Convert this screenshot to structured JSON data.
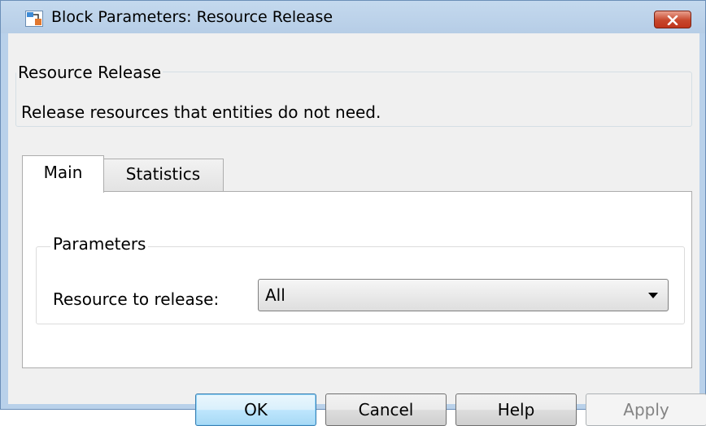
{
  "window": {
    "title": "Block Parameters: Resource Release",
    "icon": "simulink-block-icon",
    "close_icon": "close-icon"
  },
  "description": {
    "group_label": "Resource Release",
    "text": "Release resources that entities do not need."
  },
  "tabs": [
    {
      "label": "Main",
      "active": true
    },
    {
      "label": "Statistics",
      "active": false
    }
  ],
  "parameters": {
    "group_label": "Parameters",
    "resource_label": "Resource to release:",
    "resource_value": "All"
  },
  "buttons": {
    "ok": "OK",
    "cancel": "Cancel",
    "help": "Help",
    "apply": "Apply"
  },
  "colors": {
    "titlebar": "#b9d1ea",
    "close_button": "#c7472c",
    "dialog_background": "#f0f0f0",
    "default_button_accent": "#3c7fb1"
  }
}
